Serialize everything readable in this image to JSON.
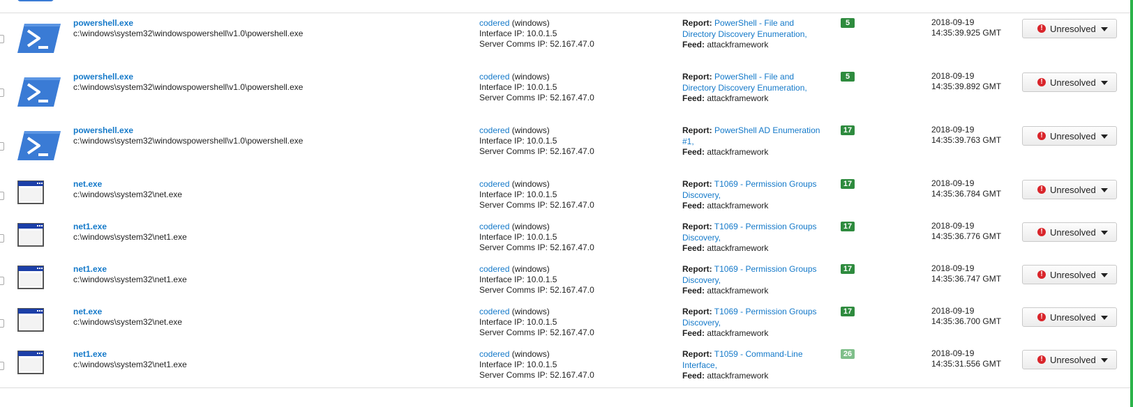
{
  "rows": [
    {
      "icon": "powershell-icon",
      "name": "powershell.exe",
      "path": "c:\\windows\\system32\\windowspowershell\\v1.0\\powershell.exe",
      "host": "codered",
      "os": " (windows)",
      "iface": "Interface IP: 10.0.1.5",
      "server": "Server Comms IP: 52.167.47.0",
      "report_label": "Report:",
      "report": "PowerShell - File and Directory Discovery Enumeration,",
      "feed_label": "Feed:",
      "feed": "attackframework",
      "score": "5",
      "date": "2018-09-19",
      "time": "14:35:39.925 GMT",
      "status": "Unresolved"
    },
    {
      "icon": "powershell-icon",
      "name": "powershell.exe",
      "path": "c:\\windows\\system32\\windowspowershell\\v1.0\\powershell.exe",
      "host": "codered",
      "os": " (windows)",
      "iface": "Interface IP: 10.0.1.5",
      "server": "Server Comms IP: 52.167.47.0",
      "report_label": "Report:",
      "report": "PowerShell - File and Directory Discovery Enumeration,",
      "feed_label": "Feed:",
      "feed": "attackframework",
      "score": "5",
      "date": "2018-09-19",
      "time": "14:35:39.892 GMT",
      "status": "Unresolved"
    },
    {
      "icon": "powershell-icon",
      "name": "powershell.exe",
      "path": "c:\\windows\\system32\\windowspowershell\\v1.0\\powershell.exe",
      "host": "codered",
      "os": " (windows)",
      "iface": "Interface IP: 10.0.1.5",
      "server": "Server Comms IP: 52.167.47.0",
      "report_label": "Report:",
      "report": "PowerShell AD Enumeration #1,",
      "feed_label": "Feed:",
      "feed": "attackframework",
      "score": "17",
      "date": "2018-09-19",
      "time": "14:35:39.763 GMT",
      "status": "Unresolved"
    },
    {
      "icon": "window-icon",
      "name": "net.exe",
      "path": "c:\\windows\\system32\\net.exe",
      "host": "codered",
      "os": " (windows)",
      "iface": "Interface IP: 10.0.1.5",
      "server": "Server Comms IP: 52.167.47.0",
      "report_label": "Report:",
      "report": "T1069 - Permission Groups Discovery,",
      "feed_label": "Feed:",
      "feed": "attackframework",
      "score": "17",
      "date": "2018-09-19",
      "time": "14:35:36.784 GMT",
      "status": "Unresolved"
    },
    {
      "icon": "window-icon",
      "name": "net1.exe",
      "path": "c:\\windows\\system32\\net1.exe",
      "host": "codered",
      "os": " (windows)",
      "iface": "Interface IP: 10.0.1.5",
      "server": "Server Comms IP: 52.167.47.0",
      "report_label": "Report:",
      "report": "T1069 - Permission Groups Discovery,",
      "feed_label": "Feed:",
      "feed": "attackframework",
      "score": "17",
      "date": "2018-09-19",
      "time": "14:35:36.776 GMT",
      "status": "Unresolved"
    },
    {
      "icon": "window-icon",
      "name": "net1.exe",
      "path": "c:\\windows\\system32\\net1.exe",
      "host": "codered",
      "os": " (windows)",
      "iface": "Interface IP: 10.0.1.5",
      "server": "Server Comms IP: 52.167.47.0",
      "report_label": "Report:",
      "report": "T1069 - Permission Groups Discovery,",
      "feed_label": "Feed:",
      "feed": "attackframework",
      "score": "17",
      "date": "2018-09-19",
      "time": "14:35:36.747 GMT",
      "status": "Unresolved"
    },
    {
      "icon": "window-icon",
      "name": "net.exe",
      "path": "c:\\windows\\system32\\net.exe",
      "host": "codered",
      "os": " (windows)",
      "iface": "Interface IP: 10.0.1.5",
      "server": "Server Comms IP: 52.167.47.0",
      "report_label": "Report:",
      "report": "T1069 - Permission Groups Discovery,",
      "feed_label": "Feed:",
      "feed": "attackframework",
      "score": "17",
      "date": "2018-09-19",
      "time": "14:35:36.700 GMT",
      "status": "Unresolved"
    },
    {
      "icon": "window-icon",
      "name": "net1.exe",
      "path": "c:\\windows\\system32\\net1.exe",
      "host": "codered",
      "os": " (windows)",
      "iface": "Interface IP: 10.0.1.5",
      "server": "Server Comms IP: 52.167.47.0",
      "report_label": "Report:",
      "report": "T1059 - Command-Line Interface,",
      "feed_label": "Feed:",
      "feed": "attackframework",
      "score": "26",
      "date": "2018-09-19",
      "time": "14:35:31.556 GMT",
      "status": "Unresolved"
    }
  ],
  "colors": {
    "link": "#1479c9",
    "badge": "#2e8b3e",
    "badge_light": "#7fbf8a",
    "alert": "#d9242a",
    "accent": "#2cb34a"
  }
}
